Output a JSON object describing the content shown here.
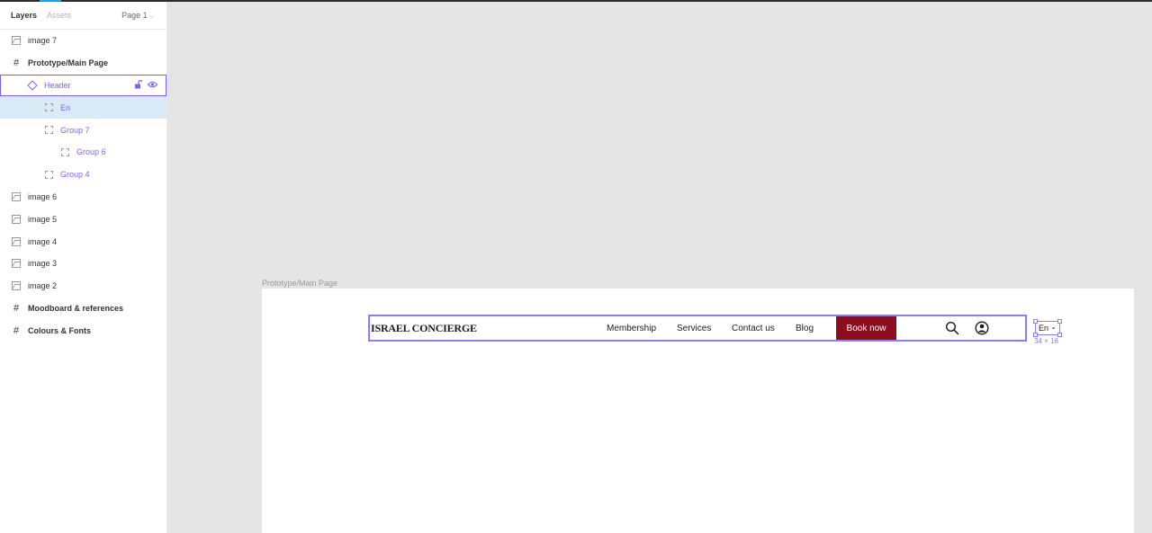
{
  "panel": {
    "tabs": {
      "layers": "Layers",
      "assets": "Assets"
    },
    "page": "Page 1",
    "layers": [
      {
        "label": "image 7",
        "icon": "image-icon",
        "indent": 0,
        "bold": false
      },
      {
        "label": "Prototype/Main Page",
        "icon": "frame-icon",
        "indent": 0,
        "bold": true
      },
      {
        "label": "Header",
        "icon": "component-icon",
        "indent": 1,
        "bold": false,
        "purple": true,
        "selected": true
      },
      {
        "label": "En",
        "icon": "group-icon",
        "indent": 2,
        "bold": false,
        "purple": true,
        "highlight": true
      },
      {
        "label": "Group 7",
        "icon": "group-icon",
        "indent": 2,
        "bold": false,
        "purple": true
      },
      {
        "label": "Group 6",
        "icon": "group-icon",
        "indent": 3,
        "bold": false,
        "purple": true
      },
      {
        "label": "Group 4",
        "icon": "group-icon",
        "indent": 2,
        "bold": false,
        "purple": true
      },
      {
        "label": "image 6",
        "icon": "image-icon",
        "indent": 0,
        "bold": false
      },
      {
        "label": "image 5",
        "icon": "image-icon",
        "indent": 0,
        "bold": false
      },
      {
        "label": "image 4",
        "icon": "image-icon",
        "indent": 0,
        "bold": false
      },
      {
        "label": "image 3",
        "icon": "image-icon",
        "indent": 0,
        "bold": false
      },
      {
        "label": "image 2",
        "icon": "image-icon",
        "indent": 0,
        "bold": false
      },
      {
        "label": "Moodboard & references",
        "icon": "frame-icon",
        "indent": 0,
        "bold": true
      },
      {
        "label": "Colours & Fonts",
        "icon": "frame-icon",
        "indent": 0,
        "bold": true
      }
    ]
  },
  "canvas": {
    "frame_label": "Prototype/Main Page",
    "header": {
      "logo": "ISRAEL CONCIERGE",
      "nav": [
        "Membership",
        "Services",
        "Contact us",
        "Blog"
      ],
      "book_label": "Book now"
    },
    "lang": {
      "label": "En",
      "size": "34 × 16"
    }
  },
  "colors": {
    "accent": "#7b61ff",
    "brand": "#8b0e1f",
    "canvas_bg": "#e5e5e5"
  }
}
